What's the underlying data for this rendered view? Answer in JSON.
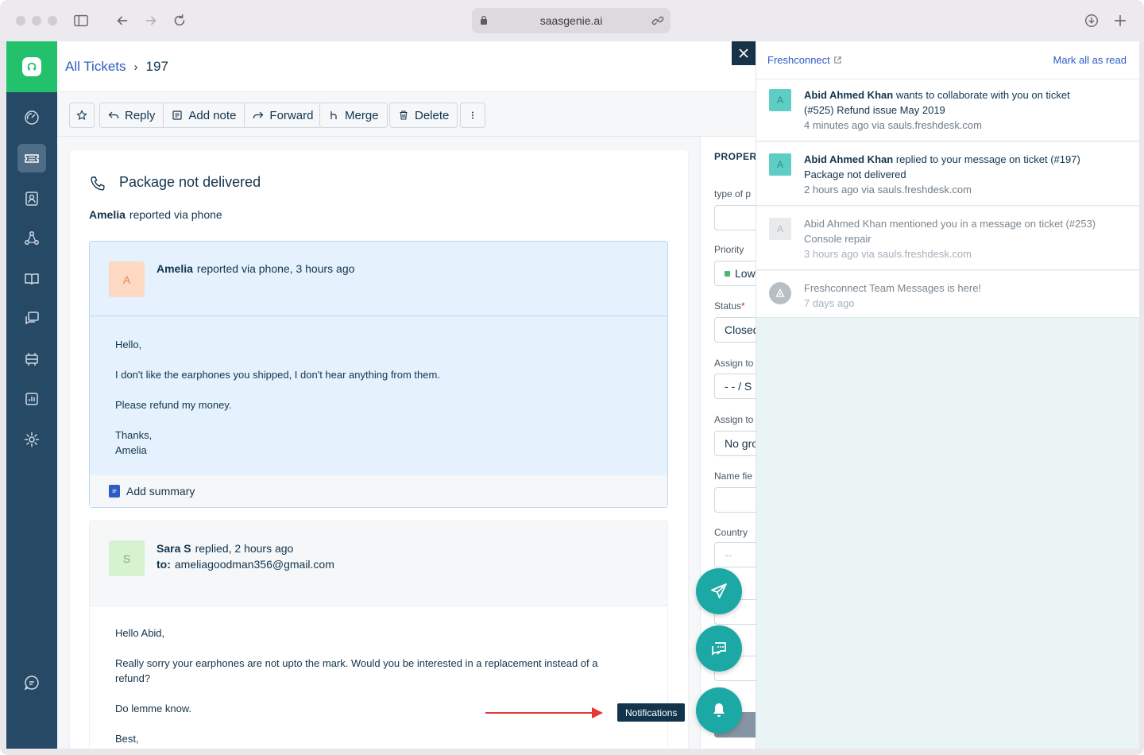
{
  "browser": {
    "url": "saasgenie.ai"
  },
  "breadcrumb": {
    "parent": "All Tickets",
    "current": "197"
  },
  "toolbar": {
    "reply": "Reply",
    "add_note": "Add note",
    "forward": "Forward",
    "merge": "Merge",
    "delete": "Delete"
  },
  "ticket": {
    "title": "Package not delivered",
    "requester": "Amelia",
    "reported_via": "reported via phone"
  },
  "message1": {
    "avatar": "A",
    "author": "Amelia",
    "meta": "reported via phone, 3 hours ago",
    "lines": [
      "Hello,",
      "I don't like the earphones you shipped, I don't hear anything from them.",
      "Please refund my money.",
      "Thanks,",
      "Amelia"
    ],
    "summary_label": "Add summary"
  },
  "message2": {
    "avatar": "S",
    "author": "Sara S",
    "meta": "replied, 2 hours ago",
    "to_label": "to:",
    "to_email": "ameliagoodman356@gmail.com",
    "lines": [
      "Hello Abid,",
      "Really sorry your earphones are not upto the mark. Would you be interested in a replacement instead of a",
      "refund?",
      "Do lemme know.",
      "Best,"
    ]
  },
  "properties": {
    "title": "PROPERT",
    "type_label": "type of p",
    "priority_label": "Priority",
    "priority_value": "Low",
    "status_label": "Status",
    "status_value": "Closed",
    "assign_agent_label": "Assign to",
    "assign_agent_value": "- - / S",
    "assign_group_label": "Assign to",
    "assign_group_value": "No gro",
    "name_label": "Name fie",
    "country_label": "Country",
    "country_value": "--"
  },
  "notifications": {
    "title": "Freshconnect",
    "mark_all": "Mark all as read",
    "items": [
      {
        "avatar": "A",
        "actor": "Abid Ahmed Khan",
        "text": "wants to collaborate with you on ticket",
        "detail": "(#525) Refund issue May 2019",
        "time": "4 minutes ago via sauls.freshdesk.com"
      },
      {
        "avatar": "A",
        "actor": "Abid Ahmed Khan",
        "text": "replied to your message on ticket (#197)",
        "detail": "Package not delivered",
        "time": "2 hours ago via sauls.freshdesk.com"
      },
      {
        "avatar": "A",
        "actor": "Abid Ahmed Khan",
        "text": "mentioned you in a message on ticket (#253)",
        "detail": "Console repair",
        "time": "3 hours ago via sauls.freshdesk.com"
      },
      {
        "text": "Freshconnect Team Messages is here!",
        "time": "7 days ago"
      }
    ]
  },
  "fab": {
    "tooltip": "Notifications"
  },
  "colors": {
    "brand_green": "#23c16b",
    "sidebar": "#264966",
    "link_blue": "#2c5cc5",
    "fab_teal": "#1ca9a5",
    "annotation_red": "#e53935"
  },
  "icons": [
    "sidebar-toggle-icon",
    "back-icon",
    "forward-icon",
    "reload-icon",
    "lock-icon",
    "link-icon",
    "download-icon",
    "new-tab-icon",
    "dashboard-icon",
    "tickets-icon",
    "contacts-icon",
    "social-icon",
    "solutions-icon",
    "forums-icon",
    "admin-icon",
    "reports-icon",
    "settings-icon",
    "chat-icon",
    "star-icon",
    "reply-icon",
    "note-icon",
    "forward-arrow-icon",
    "merge-icon",
    "trash-icon",
    "more-icon",
    "phone-icon",
    "close-icon",
    "external-link-icon",
    "send-icon",
    "messages-icon",
    "bell-icon"
  ]
}
